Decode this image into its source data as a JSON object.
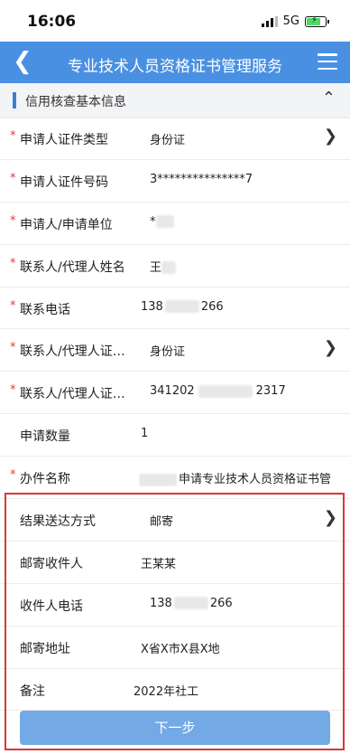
{
  "status_bar": {
    "time": "16:06",
    "network": "5G"
  },
  "navbar": {
    "back_icon": "chevron-left-icon",
    "title": "专业技术人员资格证书管理服务",
    "menu_icon": "menu-icon"
  },
  "section": {
    "title": "信用核查基本信息",
    "caret_icon": "chevron-up-icon"
  },
  "rows": [
    {
      "required": true,
      "label": "申请人证件类型",
      "value": "身份证",
      "chevron": true
    },
    {
      "required": true,
      "label": "申请人证件号码",
      "value": "3***************7",
      "chevron": false
    },
    {
      "required": true,
      "label": "申请人/申请单位",
      "value": "*",
      "chevron": false
    },
    {
      "required": true,
      "label": "联系人/代理人姓名",
      "value": "王",
      "chevron": false
    },
    {
      "required": true,
      "label": "联系电话",
      "value_a": "138",
      "value_b": "266",
      "chevron": false
    },
    {
      "required": true,
      "label": "联系人/代理人证…",
      "value": "身份证",
      "chevron": true
    },
    {
      "required": true,
      "label": "联系人/代理人证…",
      "value_a": "341202",
      "value_b": "2317",
      "chevron": false
    },
    {
      "required": false,
      "label": "申请数量",
      "value": "1",
      "chevron": false
    },
    {
      "required": true,
      "label": "办件名称",
      "value": "申请专业技术人员资格证书管",
      "chevron": false
    },
    {
      "required": false,
      "label": "结果送达方式",
      "value": "邮寄",
      "chevron": true
    },
    {
      "required": false,
      "label": "邮寄收件人",
      "value": "王某某",
      "chevron": false
    },
    {
      "required": false,
      "label": "收件人电话",
      "value_a": "138",
      "value_b": "266",
      "chevron": false
    },
    {
      "required": false,
      "label": "邮寄地址",
      "value": "X省X市X县X地",
      "chevron": false
    },
    {
      "required": false,
      "label": "备注",
      "value": "2022年社工",
      "chevron": false
    }
  ],
  "next_button": {
    "label": "下一步"
  },
  "colors": {
    "navbar": "#4a90e2",
    "required": "#e53935",
    "highlight_border": "#d93636",
    "button": "#73aae6"
  }
}
